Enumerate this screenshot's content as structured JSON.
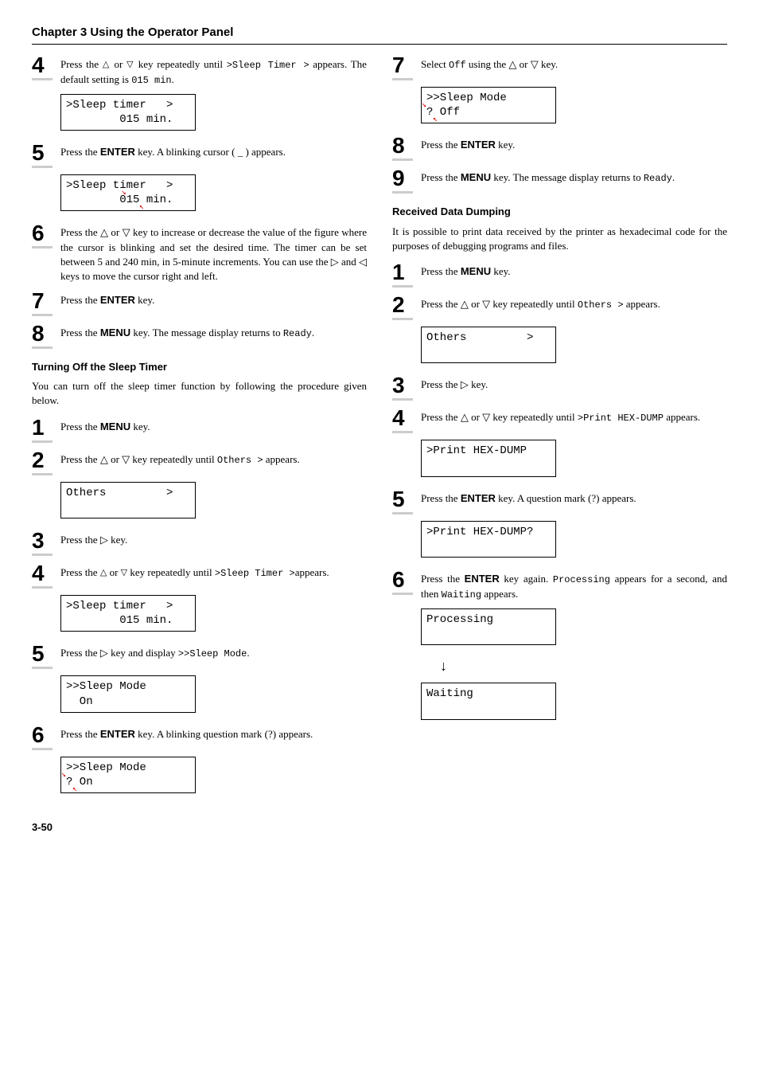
{
  "chapter": "Chapter 3  Using the Operator Panel",
  "pageNum": "3-50",
  "left": {
    "step4": {
      "pre": "Press the ",
      "mid": " key repeatedly until ",
      "code1": ">Sleep Timer >",
      "mid2": "appears. The default setting is ",
      "code2": "015 min",
      "post": "."
    },
    "lcd1a": ">Sleep timer   >",
    "lcd1b": "        015 min.",
    "step5": {
      "pre": "Press the ",
      "key": "ENTER",
      "post": " key. A blinking cursor ( _ ) appears."
    },
    "lcd2a": ">Sleep timer   >",
    "lcd2b": "        015 min.",
    "step6": "Press the △ or ▽ key to increase or decrease the value of the figure where the cursor is blinking and set the desired time. The timer can be set between 5 and 240 min, in 5-minute increments. You can use the ▷ and ◁  keys to move the cursor right and left.",
    "step7": {
      "pre": "Press the ",
      "key": "ENTER",
      "post": " key."
    },
    "step8": {
      "pre": "Press the ",
      "key": "MENU",
      "post": " key. The message display returns to ",
      "code": "Ready",
      "post2": "."
    },
    "turnoffHeading": "Turning Off the Sleep Timer",
    "turnoffIntro": "You can turn off the sleep timer function by following the procedure given below.",
    "b_step1": {
      "pre": "Press the ",
      "key": "MENU",
      "post": " key."
    },
    "b_step2": {
      "pre": "Press the △ or ▽ key repeatedly until ",
      "code": "Others >",
      "post": " appears."
    },
    "lcd3a": "Others         >",
    "b_step3": "Press the ▷ key.",
    "b_step4": {
      "pre": "Press the ",
      "mid": " key repeatedly until ",
      "code": ">Sleep Timer >",
      "post": "appears."
    },
    "lcd4a": ">Sleep timer   >",
    "lcd4b": "        015 min.",
    "b_step5": {
      "pre": "Press the ▷ key and display ",
      "code": ">>Sleep Mode",
      "post": "."
    },
    "lcd5a": ">>Sleep Mode",
    "lcd5b": "  On",
    "b_step6": {
      "pre": "Press the ",
      "key": "ENTER",
      "post": " key. A blinking question mark (?) appears."
    },
    "lcd6a": ">>Sleep Mode",
    "lcd6b": "? On"
  },
  "right": {
    "step7": {
      "pre": "Select ",
      "code": "Off",
      "post": " using the △ or ▽ key."
    },
    "lcd7a": ">>Sleep Mode",
    "lcd7b": "? Off",
    "step8": {
      "pre": "Press the ",
      "key": "ENTER",
      "post": " key."
    },
    "step9": {
      "pre": "Press the ",
      "key": "MENU",
      "post": " key. The message display returns to ",
      "code": "Ready",
      "post2": "."
    },
    "rddHeading": "Received Data Dumping",
    "rddIntro": "It is possible to print data received by the printer as hexadecimal code for the purposes of debugging programs and files.",
    "c_step1": {
      "pre": "Press the ",
      "key": "MENU",
      "post": " key."
    },
    "c_step2": {
      "pre": "Press the △ or ▽ key repeatedly until ",
      "code": "Others >",
      "post": " appears."
    },
    "lcd8a": "Others         >",
    "c_step3": "Press the ▷ key.",
    "c_step4": {
      "pre": "Press the △ or ▽ key repeatedly until ",
      "code": ">Print HEX-DUMP",
      "post": " appears."
    },
    "lcd9a": ">Print HEX-DUMP",
    "c_step5": {
      "pre": "Press the ",
      "key": "ENTER",
      "post": " key. A question mark (?) appears."
    },
    "lcd10a": ">Print HEX-DUMP?",
    "c_step6": {
      "pre": "Press the ",
      "key": "ENTER",
      "post": " key again. ",
      "code": "Processing",
      "mid": " appears for a second, and then ",
      "code2": "Waiting",
      "post2": " appears."
    },
    "lcd11a": "Processing",
    "lcd12a": "Waiting"
  }
}
